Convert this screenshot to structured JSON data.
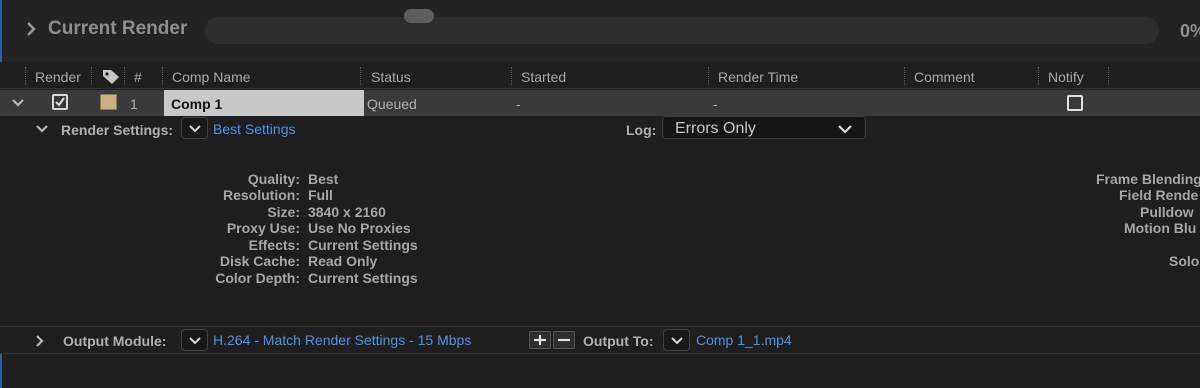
{
  "current_render": {
    "title": "Current Render",
    "percent": "0%",
    "progress": 0
  },
  "columns": {
    "render": "Render",
    "number": "#",
    "comp_name": "Comp Name",
    "status": "Status",
    "started": "Started",
    "render_time": "Render Time",
    "comment": "Comment",
    "notify": "Notify"
  },
  "queue_item": {
    "index": "1",
    "comp_name": "Comp 1",
    "status": "Queued",
    "started": "-",
    "render_time": "-",
    "render_checked": true,
    "notify_checked": false,
    "label_color": "#c9b184"
  },
  "render_settings": {
    "label": "Render Settings:",
    "value": "Best Settings",
    "log_label": "Log:",
    "log_value": "Errors Only",
    "details": [
      {
        "key": "Quality:",
        "value": "Best"
      },
      {
        "key": "Resolution:",
        "value": "Full"
      },
      {
        "key": "Size:",
        "value": "3840 x 2160"
      },
      {
        "key": "Proxy Use:",
        "value": "Use No Proxies"
      },
      {
        "key": "Effects:",
        "value": "Current Settings"
      },
      {
        "key": "Disk Cache:",
        "value": "Read Only"
      },
      {
        "key": "Color Depth:",
        "value": "Current Settings"
      }
    ],
    "right_details": [
      "Frame Blending",
      "Field Rende",
      "Pulldow",
      "Motion Blu",
      "Solo"
    ]
  },
  "output_module": {
    "label": "Output Module:",
    "value": "H.264 - Match Render Settings - 15 Mbps",
    "add_symbol": "+",
    "remove_symbol": "−",
    "output_to_label": "Output To:",
    "output_to_value": "Comp 1_1.mp4"
  },
  "colors": {
    "accent_blue": "#4c93e6",
    "selection_bar": "#2b5fa8"
  }
}
